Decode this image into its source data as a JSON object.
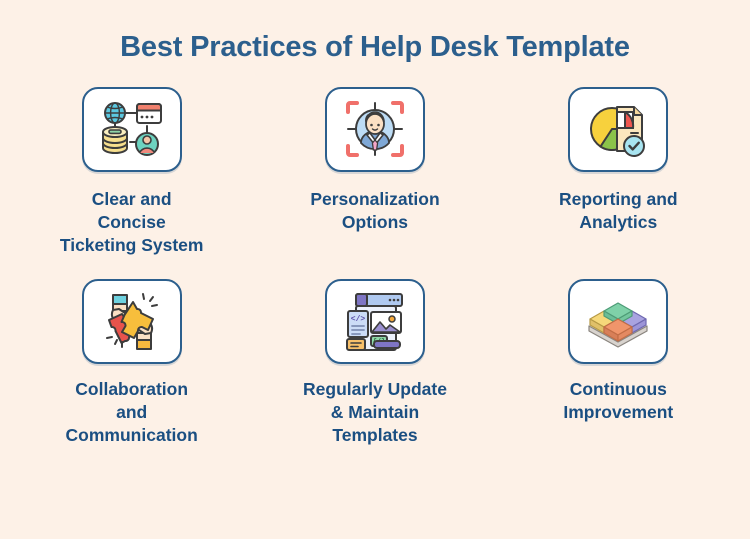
{
  "title": "Best Practices of Help Desk Template",
  "colors": {
    "background": "#FDF1E7",
    "card_background": "#FFFFFF",
    "card_border": "#2C5F8D",
    "title_text": "#2C5F8D",
    "label_text": "#1B4F82"
  },
  "items": [
    {
      "icon": "network-database-user-icon",
      "label": "Clear and\nConcise\nTicketing System"
    },
    {
      "icon": "person-target-focus-icon",
      "label": "Personalization\nOptions"
    },
    {
      "icon": "pie-chart-report-check-icon",
      "label": "Reporting and\nAnalytics"
    },
    {
      "icon": "hands-puzzle-pieces-icon",
      "label": "Collaboration\nand\nCommunication"
    },
    {
      "icon": "web-page-template-icon",
      "label": "Regularly Update\n& Maintain\nTemplates"
    },
    {
      "icon": "stacked-blocks-isometric-icon",
      "label": "Continuous\nImprovement"
    }
  ]
}
